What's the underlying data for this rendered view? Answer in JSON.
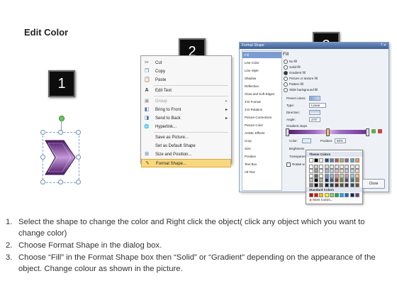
{
  "title": "Edit Color",
  "badges": [
    "1",
    "2",
    "3"
  ],
  "context_menu": {
    "items": [
      {
        "label": "Cut",
        "icon": "cut-icon",
        "glyph": "✂",
        "disabled": false,
        "submenu": false
      },
      {
        "label": "Copy",
        "icon": "copy-icon",
        "glyph": "❐",
        "disabled": false,
        "submenu": false
      },
      {
        "label": "Paste",
        "icon": "paste-icon",
        "glyph": "📋",
        "disabled": false,
        "submenu": false
      },
      {
        "label": "Edit Text",
        "icon": "edit-text-icon",
        "glyph": "A",
        "disabled": false,
        "submenu": false
      },
      {
        "label": "Group",
        "icon": "group-icon",
        "glyph": "▣",
        "disabled": true,
        "submenu": true
      },
      {
        "label": "Bring to Front",
        "icon": "bring-to-front-icon",
        "glyph": "◧",
        "disabled": false,
        "submenu": true
      },
      {
        "label": "Send to Back",
        "icon": "send-to-back-icon",
        "glyph": "◨",
        "disabled": false,
        "submenu": true
      },
      {
        "label": "Hyperlink...",
        "icon": "hyperlink-icon",
        "glyph": "🌐",
        "disabled": false,
        "submenu": false
      },
      {
        "label": "Save as Picture...",
        "icon": "",
        "glyph": "",
        "disabled": false,
        "submenu": false
      },
      {
        "label": "Set as Default Shape",
        "icon": "",
        "glyph": "",
        "disabled": false,
        "submenu": false
      },
      {
        "label": "Size and Position...",
        "icon": "size-position-icon",
        "glyph": "⊞",
        "disabled": false,
        "submenu": false
      },
      {
        "label": "Format Shape...",
        "icon": "format-shape-icon",
        "glyph": "✎",
        "disabled": false,
        "submenu": false,
        "highlighted": true
      }
    ]
  },
  "dialog": {
    "title": "Format Shape",
    "categories": [
      "Fill",
      "Line Color",
      "Line Style",
      "Shadow",
      "Reflection",
      "Glow and Soft Edges",
      "3-D Format",
      "3-D Rotation",
      "Picture Corrections",
      "Picture Color",
      "Artistic Effects",
      "Crop",
      "Size",
      "Position",
      "Text Box",
      "Alt Text"
    ],
    "heading": "Fill",
    "fill_options": [
      {
        "label": "No fill",
        "selected": false
      },
      {
        "label": "Solid fill",
        "selected": false
      },
      {
        "label": "Gradient fill",
        "selected": true
      },
      {
        "label": "Picture or texture fill",
        "selected": false
      },
      {
        "label": "Pattern fill",
        "selected": false
      },
      {
        "label": "Slide background fill",
        "selected": false
      }
    ],
    "preset_colors_label": "Preset colors:",
    "type_label": "Type:",
    "type_value": "Linear",
    "direction_label": "Direction:",
    "angle_label": "Angle:",
    "angle_value": "270°",
    "gradient_stops_label": "Gradient stops",
    "color_label": "Color:",
    "position_label": "Position:",
    "position_value": "50%",
    "brightness_label": "Brightness",
    "transparency_label": "Transparency",
    "rotate_label": "Rotate w",
    "close_label": "Close",
    "theme_colors_label": "Theme Colors",
    "standard_colors_label": "Standard Colors",
    "more_colors_label": "More Colors...",
    "gradient_colors": [
      "#4b1a66",
      "#a070c0",
      "#d9b8ea",
      "#6d2d8f"
    ],
    "theme_top_row": [
      "#ffffff",
      "#000000",
      "#eeece1",
      "#1f497d",
      "#4f81bd",
      "#c0504d",
      "#9bbb59",
      "#8064a2",
      "#4bacc6",
      "#f79646"
    ],
    "standard_row": [
      "#c00000",
      "#ff0000",
      "#ffc000",
      "#ffff00",
      "#92d050",
      "#00b050",
      "#00b0f0",
      "#0070c0",
      "#002060",
      "#7030a0"
    ]
  },
  "instructions": [
    {
      "num": "1.",
      "text": "Select the shape to change the color and Right click the object( click any object which you want to change color)"
    },
    {
      "num": "2.",
      "text": "Choose Format Shape in the dialog box."
    },
    {
      "num": "3.",
      "text": "Choose “Fill” in the Format Shape box then “Solid” or “Gradient” depending on the appearance of the object. Change colour as shown in the picture."
    }
  ]
}
